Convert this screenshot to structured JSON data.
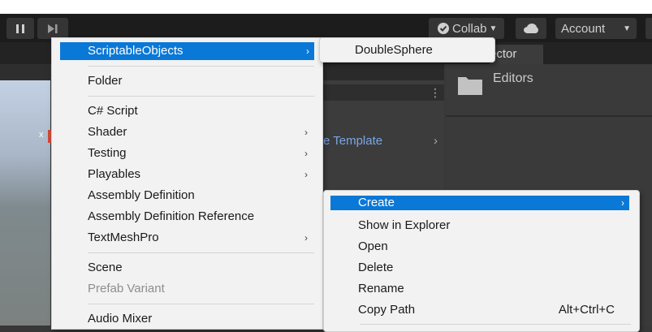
{
  "toolbar": {
    "collab_label": "Collab",
    "account_label": "Account"
  },
  "inspector_tab_label": "ector",
  "project": {
    "template_text": "e Template",
    "template_chevron": "›"
  },
  "scene": {
    "axis_label": "x"
  },
  "inspector": {
    "folder_name": "Editors"
  },
  "context_menu": {
    "highlighted": "ScriptableObjects",
    "items": [
      {
        "label": "Folder"
      },
      {
        "label": "C# Script"
      },
      {
        "label": "Shader",
        "submenu": true
      },
      {
        "label": "Testing",
        "submenu": true
      },
      {
        "label": "Playables",
        "submenu": true
      },
      {
        "label": "Assembly Definition"
      },
      {
        "label": "Assembly Definition Reference"
      },
      {
        "label": "TextMeshPro",
        "submenu": true
      },
      {
        "label": "Scene"
      },
      {
        "label": "Prefab Variant",
        "disabled": true
      },
      {
        "label": "Audio Mixer"
      }
    ]
  },
  "submenu": {
    "items": [
      {
        "label": "DoubleSphere"
      }
    ]
  },
  "project_context_menu": {
    "items": [
      {
        "label": "Create",
        "submenu": true
      },
      {
        "label": "Show in Explorer"
      },
      {
        "label": "Open"
      },
      {
        "label": "Delete"
      },
      {
        "label": "Rename"
      },
      {
        "label": "Copy Path",
        "shortcut": "Alt+Ctrl+C"
      }
    ]
  },
  "glyphs": {
    "submenu_arrow": "›",
    "dropdown_caret": "▼",
    "kebab": "⋮"
  },
  "colors": {
    "highlight": "#0a78d7",
    "link_blue": "#7aa7e4"
  }
}
